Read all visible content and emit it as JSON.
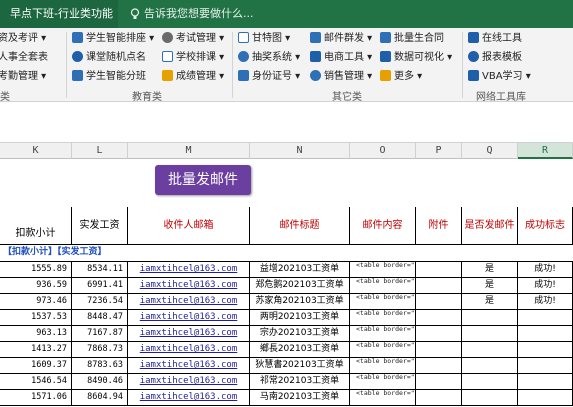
{
  "tabs": {
    "active": "早点下班-行业类功能",
    "tell_me": "告诉我您想要做什么..."
  },
  "ribbon": {
    "col1": [
      "资及考评 ▾",
      "人事全套表",
      "考勤管理 ▾"
    ],
    "group1_label": "类",
    "col2": [
      "学生智能排座 ▾",
      "课堂随机点名",
      "学生智能分班"
    ],
    "col3": [
      "考试管理 ▾",
      "学校排课 ▾",
      "成绩管理 ▾"
    ],
    "group2_label": "教育类",
    "col4": [
      "甘特图 ▾",
      "抽奖系统 ▾",
      "身份证号 ▾"
    ],
    "col5": [
      "邮件群发 ▾",
      "电商工具 ▾",
      "销售管理 ▾"
    ],
    "col6": [
      "批量生合同",
      "数据可视化 ▾",
      "更多 ▾"
    ],
    "group3_label": "其它类",
    "col7": [
      "在线工具",
      "报表模板",
      "VBA学习 ▾"
    ],
    "group4_label": "网络工具库"
  },
  "column_headers": [
    "K",
    "L",
    "M",
    "N",
    "O",
    "P",
    "Q",
    "R"
  ],
  "bulk_mail_button": "批量发邮件",
  "table": {
    "headers": {
      "deduct": "扣款小计",
      "actual_pay": "实发工资",
      "recipient": "收件人邮箱",
      "subject": "邮件标题",
      "content": "邮件内容",
      "attachment": "附件",
      "send_flag": "是否发邮件",
      "success": "成功标志"
    },
    "tag_deduct": "【扣款小计】",
    "tag_actual": "【实发工资】",
    "rows": [
      {
        "deduct": "1555.89",
        "actual": "8534.11",
        "email": "iamxtihcel@163.com",
        "subject": "益增202103工资单",
        "content": "<table border=\"1\"",
        "send": "是",
        "success": "成功!"
      },
      {
        "deduct": "936.59",
        "actual": "6991.41",
        "email": "iamxtihcel@163.com",
        "subject": "郑危鹅202103工资单",
        "content": "<table border=\"1\"",
        "send": "是",
        "success": "成功!"
      },
      {
        "deduct": "973.46",
        "actual": "7236.54",
        "email": "iamxtihcel@163.com",
        "subject": "苏家角202103工资单",
        "content": "<table border=\"1\"",
        "send": "是",
        "success": "成功!"
      },
      {
        "deduct": "1537.53",
        "actual": "8448.47",
        "email": "iamxtihcel@163.com",
        "subject": "两明202103工资单",
        "content": "<table border=\"1\"",
        "send": "",
        "success": ""
      },
      {
        "deduct": "963.13",
        "actual": "7167.87",
        "email": "iamxtihcel@163.com",
        "subject": "宗办202103工资单",
        "content": "<table border=\"1\"",
        "send": "",
        "success": ""
      },
      {
        "deduct": "1413.27",
        "actual": "7868.73",
        "email": "iamxtihcel@163.com",
        "subject": "鄉長202103工资单",
        "content": "<table border=\"1\"",
        "send": "",
        "success": ""
      },
      {
        "deduct": "1609.37",
        "actual": "8783.63",
        "email": "iamxtihcel@163.com",
        "subject": "狄慧書202103工资单",
        "content": "<table border=\"1\"",
        "send": "",
        "success": ""
      },
      {
        "deduct": "1546.54",
        "actual": "8490.46",
        "email": "iamxtihcel@163.com",
        "subject": "祁常202103工资单",
        "content": "<table border=\"1\"",
        "send": "",
        "success": ""
      },
      {
        "deduct": "1571.06",
        "actual": "8604.94",
        "email": "iamxtihcel@163.com",
        "subject": "马南202103工资单",
        "content": "<table border=\"1\"",
        "send": "",
        "success": ""
      }
    ]
  },
  "colors": {
    "accent": "#217346",
    "button": "#6b3fa0",
    "header_red": "#c00000"
  }
}
